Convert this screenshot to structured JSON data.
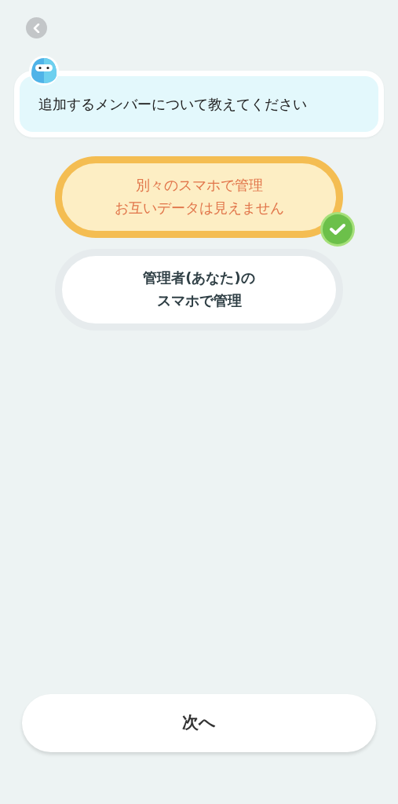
{
  "question": "追加するメンバーについて教えてください",
  "options": [
    {
      "lines": [
        "別々のスマホで管理",
        "お互いデータは見えません"
      ],
      "selected": true
    },
    {
      "lines": [
        "管理者(あなた)の",
        "スマホで管理"
      ],
      "selected": false
    }
  ],
  "next_button": "次へ"
}
